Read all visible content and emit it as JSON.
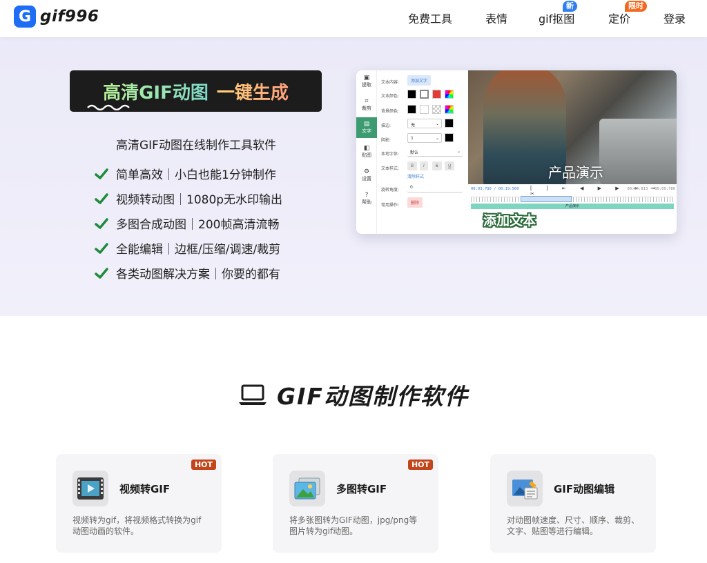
{
  "nav": {
    "logo_letter": "G",
    "logo_text": "gif996",
    "items": [
      {
        "label": "免费工具"
      },
      {
        "label": "表情"
      },
      {
        "label": "gif抠图",
        "badge": "新",
        "badge_color": "#2f7ff0"
      },
      {
        "label": "定价",
        "badge": "限时",
        "badge_color": "#f26a21"
      },
      {
        "label": "登录"
      }
    ]
  },
  "hero": {
    "title_part1": "高清GIF动图",
    "title_part2": "一键生成",
    "subtitle": "高清GIF动图在线制作工具软件",
    "features": [
      "简单高效｜小白也能1分钟制作",
      "视频转动图｜1080p无水印输出",
      "多图合成动图｜200帧高清流畅",
      "全能编辑｜边框/压缩/调速/裁剪",
      "各类动图解决方案｜你要的都有"
    ],
    "check_color": "#1e8a3c"
  },
  "preview": {
    "sidebar": [
      "提取",
      "裁剪",
      "文字",
      "贴图",
      "设置",
      "帮助"
    ],
    "active_sidebar": "文字",
    "form": {
      "content_label": "文本内容:",
      "add_text_button": "添加文字",
      "text_color_label": "文本颜色:",
      "bg_color_label": "背景颜色:",
      "stroke_label": "描边:",
      "stroke_value": "无",
      "shadow_label": "阴影:",
      "shadow_value": "1",
      "font_label": "本地字体:",
      "font_value": "默认",
      "style_label": "文本样式:",
      "style_buttons": [
        "B",
        "I",
        "S",
        "U"
      ],
      "clear_style": "清除样式",
      "rotate_label": "旋转角度:",
      "rotate_value": "0",
      "delete_label": "常用操作:",
      "delete_button": "删除"
    },
    "video_overlay_text": "产品演示",
    "time_current": "00:03:780",
    "time_total": "00:19:560",
    "time_range": "00:04:813 ~ 00:09:780",
    "track_label": "产品演示",
    "add_text_caption": "添加文本"
  },
  "section": {
    "title": "GIF动图制作软件",
    "cards": [
      {
        "title": "视频转GIF",
        "hot": "HOT",
        "desc": "视频转为gif，将视频格式转换为gif动图动画的软件。",
        "icon": "video-film-icon"
      },
      {
        "title": "多图转GIF",
        "hot": "HOT",
        "desc": "将多张图转为GIF动图，jpg/png等图片转为gif动图。",
        "icon": "images-icon"
      },
      {
        "title": "GIF动图编辑",
        "hot": "",
        "desc": "对动图帧速度、尺寸、顺序、裁剪、文字、贴图等进行编辑。",
        "icon": "edit-image-icon"
      }
    ]
  }
}
